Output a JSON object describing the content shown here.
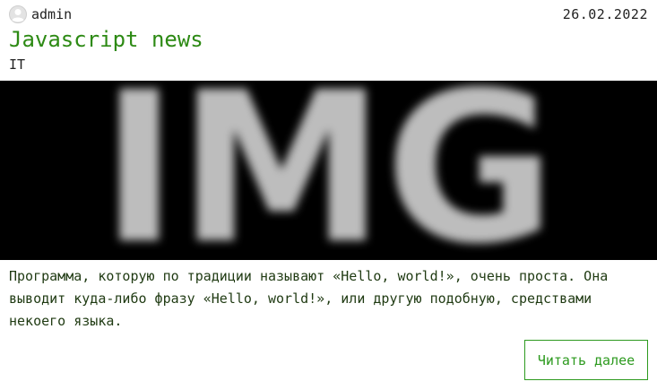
{
  "post": {
    "author": "admin",
    "date": "26.02.2022",
    "title": "Javascript news",
    "category": "IT",
    "image_alt_text": "IMG",
    "excerpt": "Программа, которую по традиции называют «Hello, world!», очень проста. Она выводит куда-либо фразу «Hello, world!», или другую подобную, средствами некоего языка.",
    "read_more_label": "Читать далее"
  },
  "icons": {
    "avatar": "user-avatar-icon"
  },
  "colors": {
    "title": "#2d8a14",
    "button": "#2d9a1f",
    "image_background": "#000000"
  }
}
